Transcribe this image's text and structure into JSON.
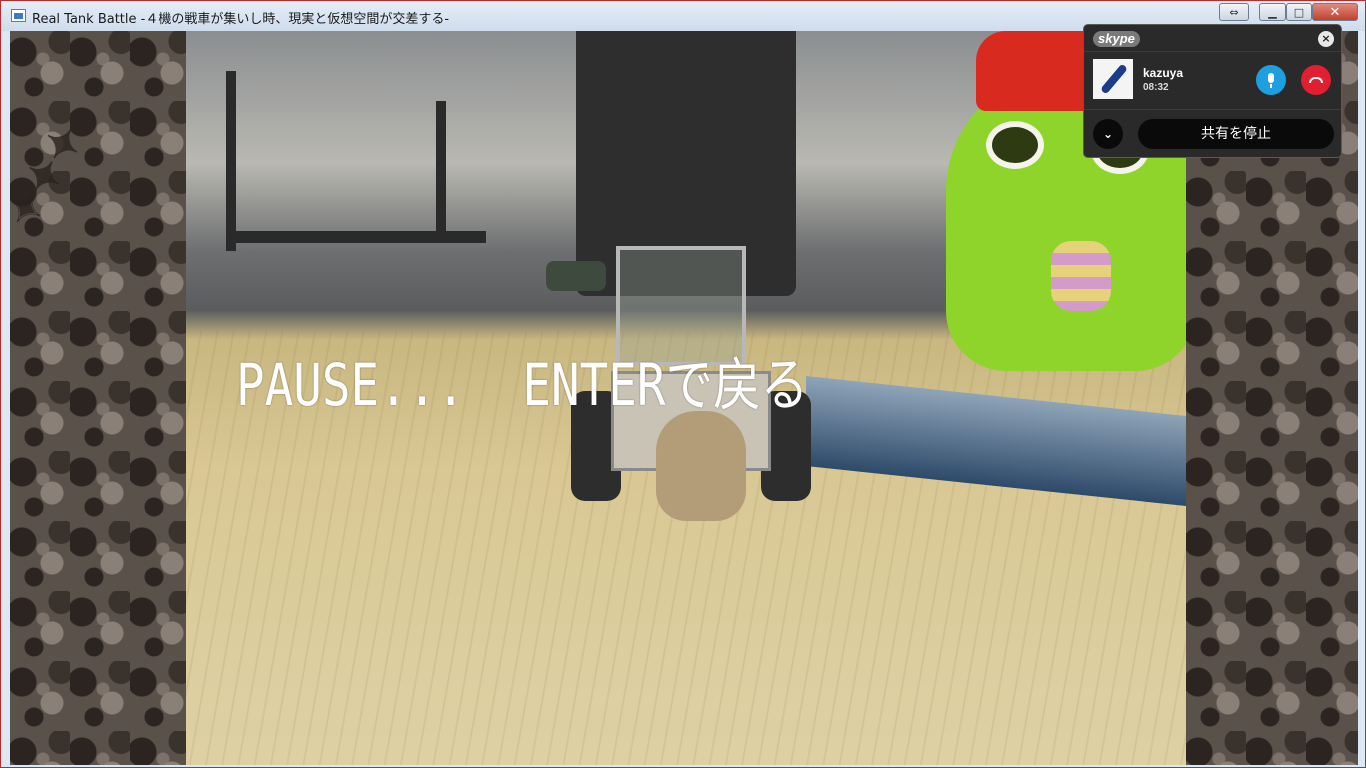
{
  "window": {
    "title": "Real Tank Battle -４機の戦車が集いし時、現実と仮想空間が交差する-",
    "controls": {
      "swap_icon": "swap-arrows-icon",
      "minimize_icon": "minimize-icon",
      "maximize_icon": "maximize-icon",
      "close_icon": "close-icon"
    }
  },
  "game": {
    "pause_message": "PAUSE...  ENTERで戻る"
  },
  "skype": {
    "logo": "skype",
    "close_symbol": "×",
    "user": {
      "name": "kazuya",
      "duration": "08:32"
    },
    "buttons": {
      "mute_icon": "microphone-icon",
      "hangup_icon": "hang-up-icon",
      "expand_symbol": "⌄",
      "stop_sharing_label": "共有を停止"
    },
    "colors": {
      "mic": "#1ea0e0",
      "hangup": "#e02030"
    }
  }
}
